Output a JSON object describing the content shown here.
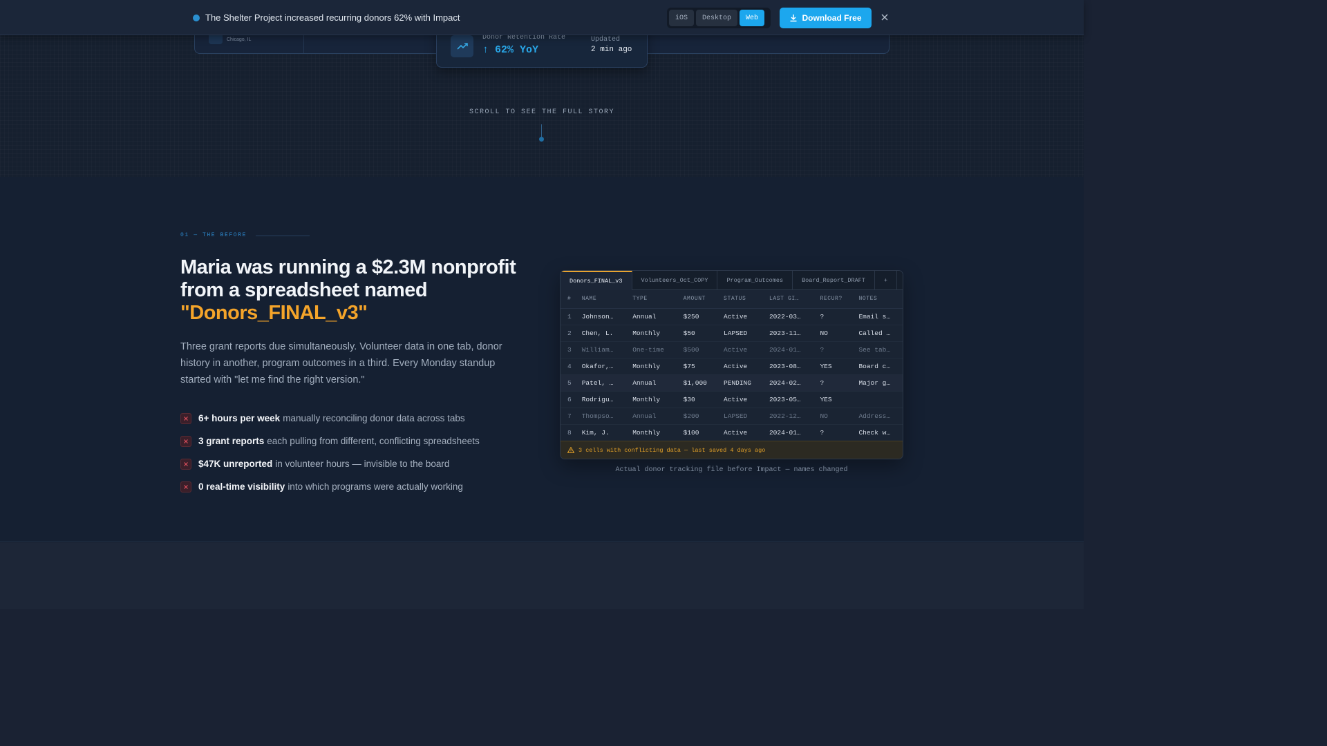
{
  "banner": {
    "message": "The Shelter Project increased recurring donors 62% with Impact",
    "platforms": [
      {
        "label": "iOS",
        "active": false
      },
      {
        "label": "Desktop",
        "active": false
      },
      {
        "label": "Web",
        "active": true
      }
    ],
    "download_label": "Download Free",
    "colors": {
      "accent": "#1ca7ee"
    },
    "icons": {
      "status": "dot-icon",
      "download": "download-icon",
      "close": "close-icon"
    }
  },
  "hero": {
    "location": "Chicago, IL",
    "stat": {
      "label": "Donor Retention Rate",
      "value": "↑ 62% YoY",
      "updated_label": "Updated",
      "updated_value": "2 min ago",
      "icon": "trending-up-icon"
    },
    "scroll_text": "SCROLL TO SEE THE FULL STORY"
  },
  "before": {
    "eyebrow": "01 — THE BEFORE",
    "headline": "Maria was running a $2.3M nonprofit from a spreadsheet named",
    "headline_highlight": "\"Donors_FINAL_v3\"",
    "paragraph": "Three grant reports due simultaneously. Volunteer data in one tab, donor history in another, program outcomes in a third. Every Monday standup started with \"let me find the right version.\"",
    "pains": [
      {
        "strong": "6+ hours per week",
        "rest": "manually reconciling donor data across tabs"
      },
      {
        "strong": "3 grant reports",
        "rest": "each pulling from different, conflicting spreadsheets"
      },
      {
        "strong": "$47K unreported",
        "rest": "in volunteer hours — invisible to the board"
      },
      {
        "strong": "0 real-time visibility",
        "rest": "into which programs were actually working"
      }
    ],
    "colors": {
      "highlight": "#f4a42a",
      "pain_icon": "#d9414f"
    }
  },
  "sheet": {
    "tabs": [
      "Donors_FINAL_v3",
      "Volunteers_Oct_COPY",
      "Program_Outcomes",
      "Board_Report_DRAFT",
      "+"
    ],
    "active_tab": 0,
    "columns": [
      "#",
      "NAME",
      "TYPE",
      "AMOUNT",
      "STATUS",
      "LAST GI…",
      "RECUR?",
      "NOTES"
    ],
    "rows": [
      [
        "1",
        "Johnson…",
        "Annual",
        "$250",
        "Active",
        "2022-03…",
        "?",
        "Email s…"
      ],
      [
        "2",
        "Chen, L.",
        "Monthly",
        "$50",
        "LAPSED",
        "2023-11…",
        "NO",
        "Called …"
      ],
      [
        "3",
        "William…",
        "One-time",
        "$500",
        "Active",
        "2024-01…",
        "?",
        "See tab…"
      ],
      [
        "4",
        "Okafor,…",
        "Monthly",
        "$75",
        "Active",
        "2023-08…",
        "YES",
        "Board c…"
      ],
      [
        "5",
        "Patel, …",
        "Annual",
        "$1,000",
        "PENDING",
        "2024-02…",
        "?",
        "Major g…"
      ],
      [
        "6",
        "Rodrigu…",
        "Monthly",
        "$30",
        "Active",
        "2023-05…",
        "YES",
        ""
      ],
      [
        "7",
        "Thompso…",
        "Annual",
        "$200",
        "LAPSED",
        "2022-12…",
        "NO",
        "Address…"
      ],
      [
        "8",
        "Kim, J.",
        "Monthly",
        "$100",
        "Active",
        "2024-01…",
        "?",
        "Check w…"
      ]
    ],
    "dim_rows": [
      2,
      6
    ],
    "highlight_row": 4,
    "warning": "3 cells with conflicting data — last saved 4 days ago",
    "caption": "Actual donor tracking file before Impact — names changed"
  }
}
